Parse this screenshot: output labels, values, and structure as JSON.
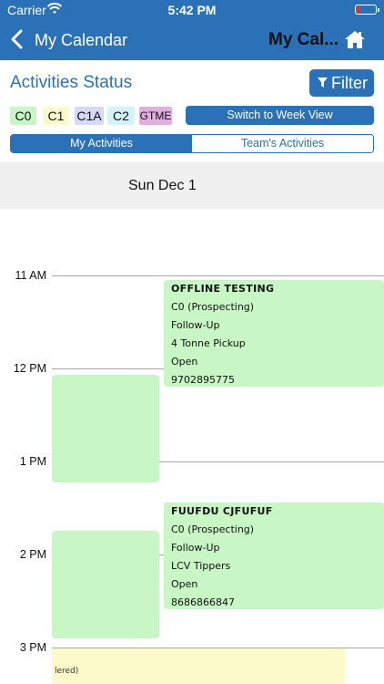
{
  "status_bar": {
    "carrier": "Carrier",
    "time": "5:42 PM"
  },
  "nav": {
    "back_label": "My Calendar",
    "title": "My Cal..."
  },
  "activities": {
    "title": "Activities Status",
    "filter_label": "Filter"
  },
  "legend": [
    {
      "label": "C0",
      "color": "#c8f7c5"
    },
    {
      "label": "C1",
      "color": "#fcfacb"
    },
    {
      "label": "C1A",
      "color": "#d4daf7"
    },
    {
      "label": "C2",
      "color": "#d4f3f7"
    },
    {
      "label": "GTME",
      "color": "#e2aee0"
    }
  ],
  "week_view_label": "Switch to Week View",
  "segments": {
    "active": "My Activities",
    "inactive": "Team's Activities"
  },
  "day": {
    "label": "Sun Dec 1"
  },
  "hours": [
    "11 AM",
    "12 PM",
    "1 PM",
    "2 PM",
    "3 PM"
  ],
  "events": [
    {
      "title": "OFFLINE TESTING",
      "category": "C0 (Prospecting)",
      "type": "Follow-Up",
      "product": "4 Tonne Pickup",
      "status": "Open",
      "phone": "9702895775"
    },
    {
      "title": "FUUFDU CJFUFUF",
      "category": "C0 (Prospecting)",
      "type": "Follow-Up",
      "product": "LCV Tippers",
      "status": "Open",
      "phone": "8686866847"
    }
  ],
  "cut_event_text": "lered)",
  "colors": {
    "primary": "#2a71b8",
    "c0": "#c8f7c5",
    "c1": "#fcfacb"
  }
}
